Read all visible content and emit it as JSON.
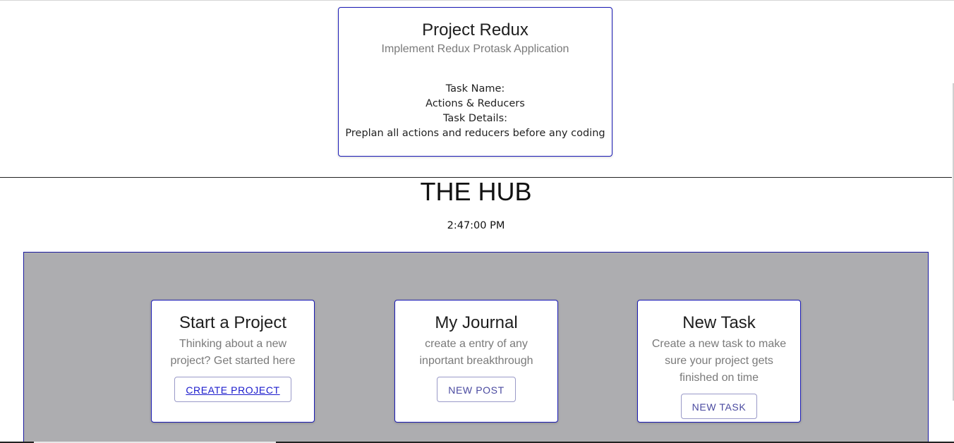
{
  "project": {
    "title": "Project Redux",
    "subtitle": "Implement Redux Protask Application",
    "task_name_label": "Task Name:",
    "task_name": "Actions & Reducers",
    "task_details_label": "Task Details:",
    "task_details": "Preplan all actions and reducers before any coding"
  },
  "hub": {
    "title": "THE HUB",
    "time": "2:47:00 PM"
  },
  "cards": [
    {
      "title": "Start a Project",
      "description": "Thinking about a new project? Get started here",
      "button": "CREATE PROJECT"
    },
    {
      "title": "My Journal",
      "description": "create a entry of any inportant breakthrough",
      "button": "NEW POST"
    },
    {
      "title": "New Task",
      "description": "Create a new task to make sure your project gets finished on time",
      "button": "NEW TASK"
    }
  ],
  "colors": {
    "card_border": "#1a1ab5",
    "panel_bg": "#adadb0",
    "button_text": "#4a4aa0"
  }
}
